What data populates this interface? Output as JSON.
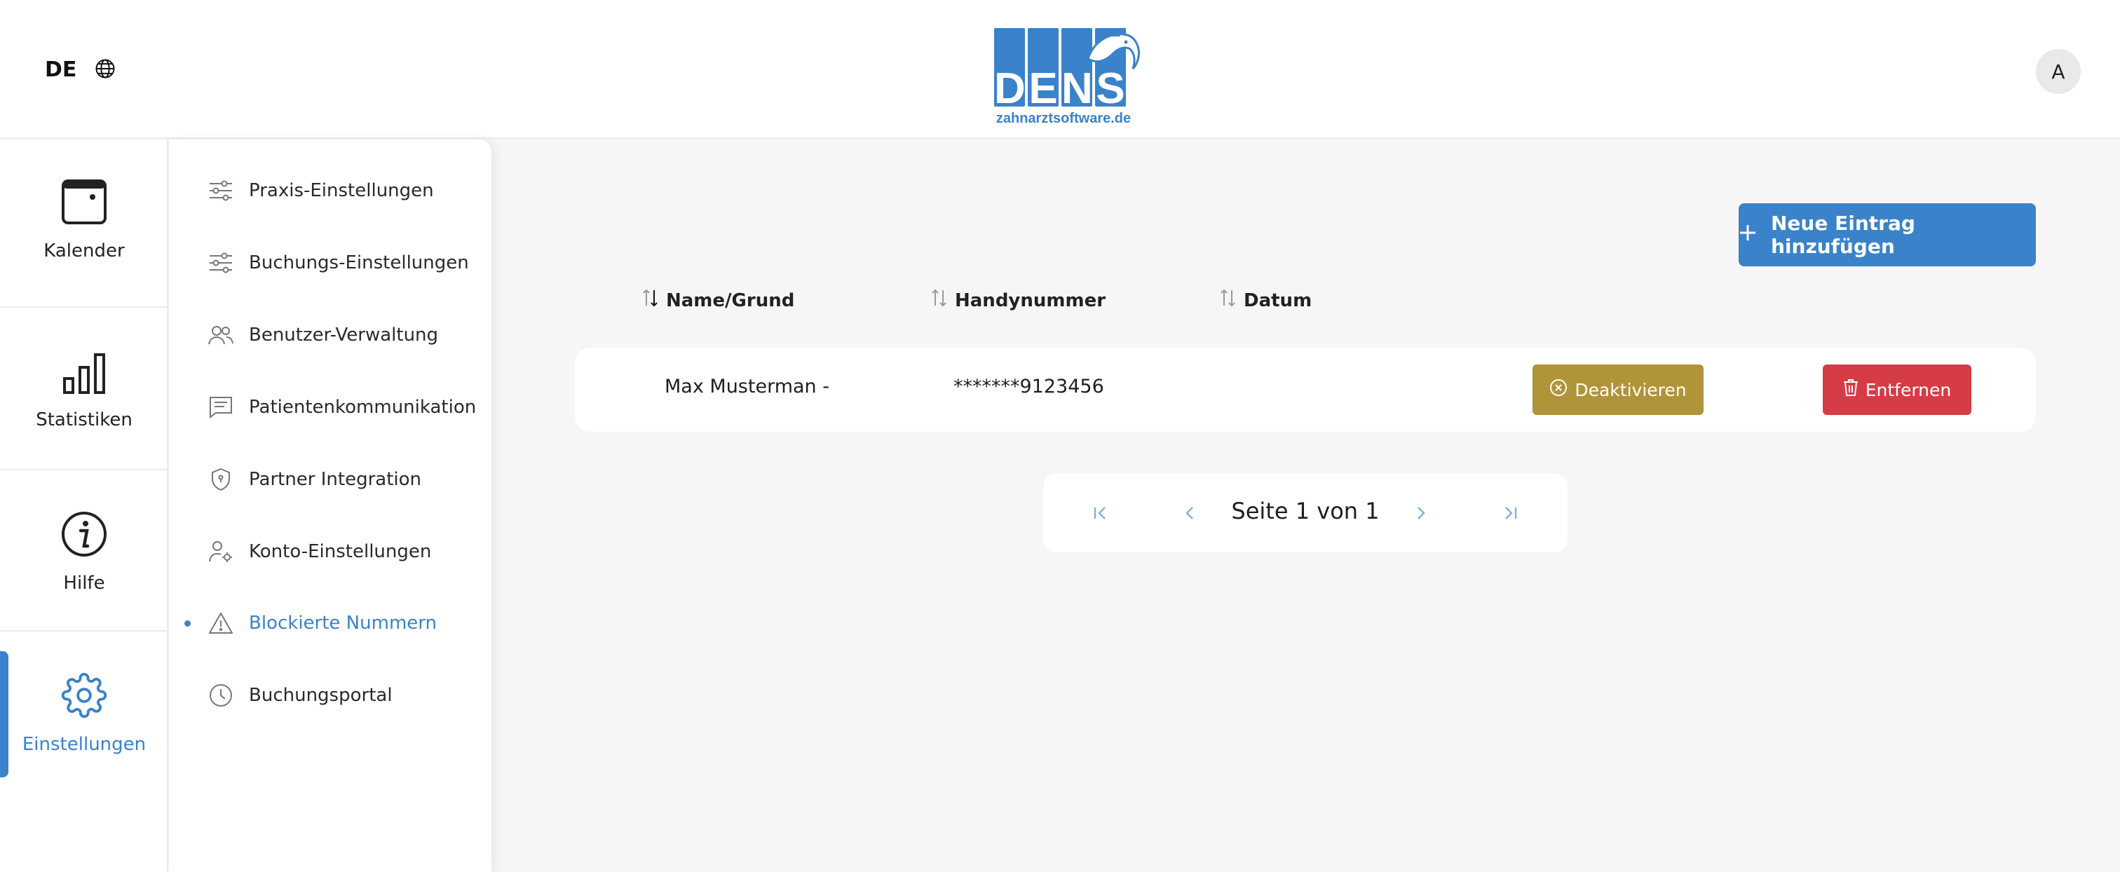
{
  "header": {
    "language": "DE",
    "language_icon": "globe-icon",
    "logo_letters": [
      "D",
      "E",
      "N",
      "S"
    ],
    "logo_subtitle": "zahnarztsoftware.de",
    "avatar_initial": "A"
  },
  "rail": {
    "items": [
      {
        "label": "Kalender",
        "icon": "calendar-icon"
      },
      {
        "label": "Statistiken",
        "icon": "bar-chart-icon"
      },
      {
        "label": "Hilfe",
        "icon": "info-icon"
      },
      {
        "label": "Einstellungen",
        "icon": "gear-icon",
        "active": true
      }
    ]
  },
  "submenu": {
    "items": [
      {
        "label": "Praxis-Einstellungen",
        "icon": "sliders-icon"
      },
      {
        "label": "Buchungs-Einstellungen",
        "icon": "sliders-icon"
      },
      {
        "label": "Benutzer-Verwaltung",
        "icon": "users-icon"
      },
      {
        "label": "Patientenkommunikation",
        "icon": "chat-icon"
      },
      {
        "label": "Partner Integration",
        "icon": "shield-icon"
      },
      {
        "label": "Konto-Einstellungen",
        "icon": "user-gear-icon"
      },
      {
        "label": "Blockierte Nummern",
        "icon": "warning-icon",
        "active": true
      },
      {
        "label": "Buchungsportal",
        "icon": "clock-icon"
      }
    ]
  },
  "main": {
    "add_button": "Neue Eintrag hinzufügen",
    "columns": [
      "Name/Grund",
      "Handynummer",
      "Datum"
    ],
    "rows": [
      {
        "name": "Max Musterman -",
        "phone": "*******9123456",
        "date": "",
        "deactivate_label": "Deaktivieren",
        "remove_label": "Entfernen"
      }
    ],
    "pagination": {
      "text": "Seite 1 von 1",
      "current_page": 1,
      "total_pages": 1
    }
  },
  "colors": {
    "accent": "#3a82c9",
    "deactivate": "#b09437",
    "remove": "#d63c45",
    "background": "#f6f6f6"
  }
}
